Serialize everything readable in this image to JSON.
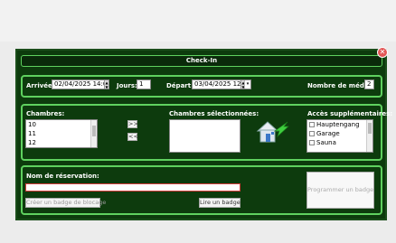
{
  "window": {
    "title": "Check-In",
    "close_icon": "close-icon",
    "accent_color": "#5fd15f",
    "background_color": "#0d3b0d",
    "close_color": "#e25656"
  },
  "dates": {
    "arrival_label": "Arrivée:",
    "arrival_value": "02/04/2025 14:00",
    "days_label": "Jours:",
    "days_value": "1",
    "departure_label": "Départ:",
    "departure_value": "03/04/2025 12:00",
    "media_label": "Nombre de médias",
    "media_value": "2"
  },
  "rooms": {
    "rooms_label": "Chambres:",
    "rooms_list": [
      "10",
      "11",
      "12"
    ],
    "add_button": ">>",
    "remove_button": "<<",
    "selected_label": "Chambres sélectionnées:",
    "assign_icon": "house-with-arrow-icon",
    "extra_access_label": "Accès supplémentaires:",
    "extra_access_items": [
      "Hauptengang",
      "Garage",
      "Sauna"
    ]
  },
  "reservation": {
    "name_label": "Nom de réservation:",
    "name_value": "",
    "lock_badge_button": "Créer un badge de blocage",
    "read_badge_button": "Lire un badge",
    "program_badge_button": "Programmer un badge"
  }
}
